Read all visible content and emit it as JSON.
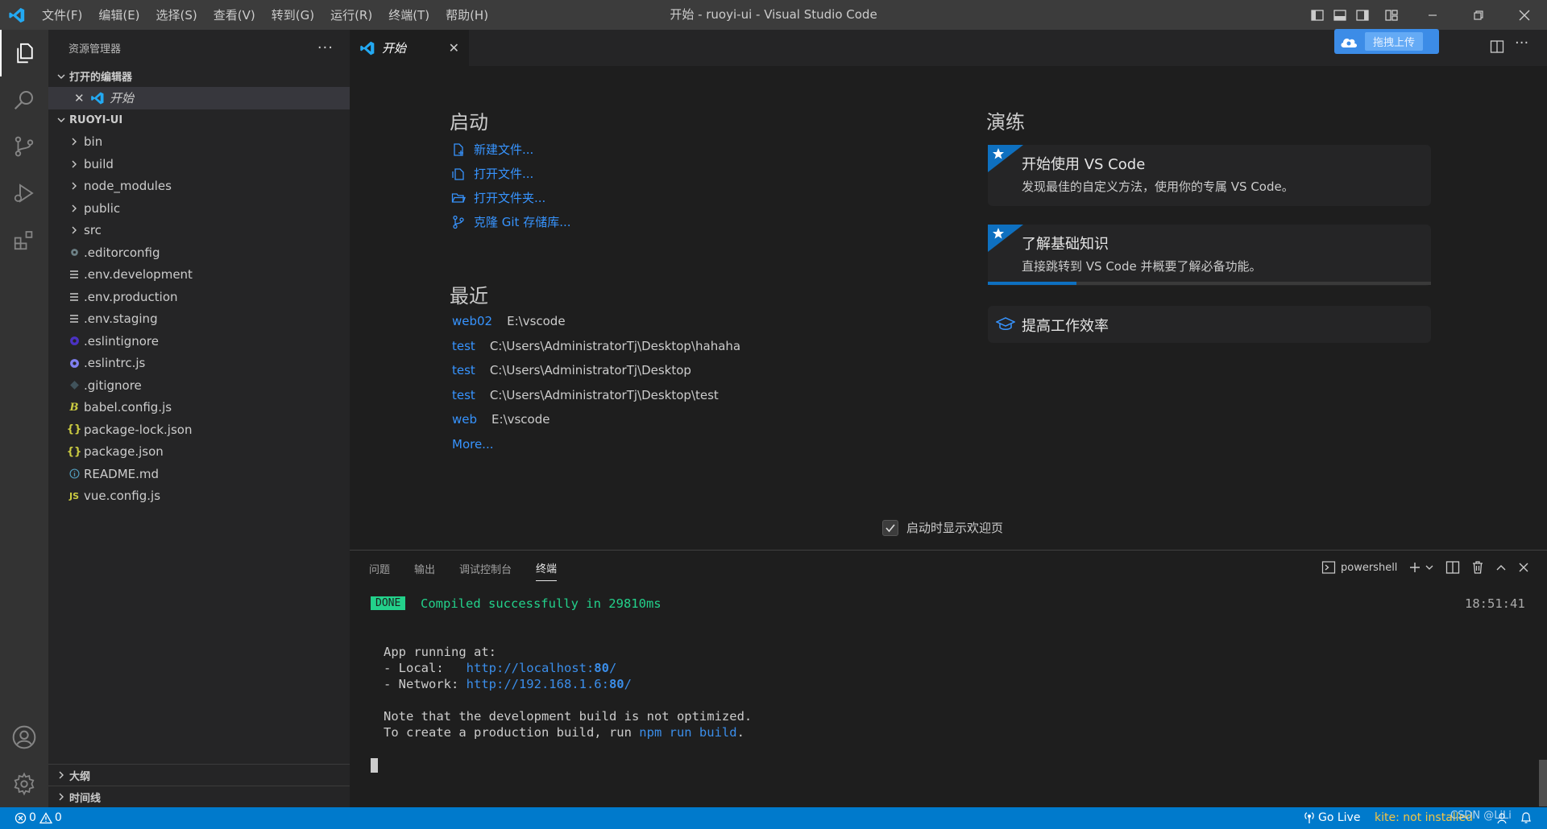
{
  "titlebar": {
    "menu": [
      "文件(F)",
      "编辑(E)",
      "选择(S)",
      "查看(V)",
      "转到(G)",
      "运行(R)",
      "终端(T)",
      "帮助(H)"
    ],
    "title": "开始 - ruoyi-ui - Visual Studio Code"
  },
  "sidebar": {
    "title": "资源管理器",
    "open_editors_label": "打开的编辑器",
    "open_editor_item": "开始",
    "project_label": "RUOYI-UI",
    "folders": [
      "bin",
      "build",
      "node_modules",
      "public",
      "src"
    ],
    "files": [
      {
        "name": ".editorconfig",
        "icon": "gear-icon",
        "color": "#6d8086"
      },
      {
        "name": ".env.development",
        "icon": "lines-icon",
        "color": "#cccccc"
      },
      {
        "name": ".env.production",
        "icon": "lines-icon",
        "color": "#cccccc"
      },
      {
        "name": ".env.staging",
        "icon": "lines-icon",
        "color": "#cccccc"
      },
      {
        "name": ".eslintignore",
        "icon": "eslint-icon",
        "color": "#4b32c3"
      },
      {
        "name": ".eslintrc.js",
        "icon": "eslint-icon",
        "color": "#8080f2"
      },
      {
        "name": ".gitignore",
        "icon": "git-icon",
        "color": "#41535b"
      },
      {
        "name": "babel.config.js",
        "icon": "babel-icon",
        "color": "#cbcb41"
      },
      {
        "name": "package-lock.json",
        "icon": "json-icon",
        "color": "#cbcb41"
      },
      {
        "name": "package.json",
        "icon": "json-icon",
        "color": "#cbcb41"
      },
      {
        "name": "README.md",
        "icon": "info-icon",
        "color": "#519aba"
      },
      {
        "name": "vue.config.js",
        "icon": "js-icon",
        "color": "#cbcb41"
      }
    ],
    "outline_label": "大纲",
    "timeline_label": "时间线"
  },
  "tab": {
    "label": "开始"
  },
  "upload_button": "拖拽上传",
  "welcome": {
    "start_heading": "启动",
    "start_links": [
      "新建文件...",
      "打开文件...",
      "打开文件夹...",
      "克隆 Git 存储库..."
    ],
    "recent_heading": "最近",
    "recent": [
      {
        "name": "web02",
        "path": "E:\\vscode"
      },
      {
        "name": "test",
        "path": "C:\\Users\\AdministratorTj\\Desktop\\hahaha"
      },
      {
        "name": "test",
        "path": "C:\\Users\\AdministratorTj\\Desktop"
      },
      {
        "name": "test",
        "path": "C:\\Users\\AdministratorTj\\Desktop\\test"
      },
      {
        "name": "web",
        "path": "E:\\vscode"
      }
    ],
    "more": "More...",
    "walkthrough_heading": "演练",
    "card1_title": "开始使用 VS Code",
    "card1_desc": "发现最佳的自定义方法，使用你的专属 VS Code。",
    "card2_title": "了解基础知识",
    "card2_desc": "直接跳转到 VS Code 并概要了解必备功能。",
    "card2_progress": 0.2,
    "card3_title": "提高工作效率",
    "show_on_startup": "启动时显示欢迎页"
  },
  "panel": {
    "tabs": [
      "问题",
      "输出",
      "调试控制台",
      "终端"
    ],
    "shell": "powershell",
    "time": "18:51:41",
    "done_badge": "DONE",
    "compiled": "Compiled successfully in 29810ms",
    "app_running": "App running at:",
    "local_label": "- Local:   ",
    "local_url_a": "http://localhost:",
    "local_url_port": "80",
    "local_url_b": "/",
    "network_label": "- Network: ",
    "network_url_a": "http://192.168.1.6:",
    "network_url_port": "80",
    "network_url_b": "/",
    "note": "Note that the development build is not optimized.",
    "create_a": "To create a production build, run ",
    "create_cmd": "npm run build",
    "create_b": "."
  },
  "statusbar": {
    "errors": "0",
    "warnings": "0",
    "go_live": "Go Live",
    "kite": "kite: not installed",
    "watermark": "CSDN @LiLi"
  },
  "colors": {
    "accent": "#007acc",
    "link": "#3794ff",
    "done_bg": "#23d18b"
  }
}
